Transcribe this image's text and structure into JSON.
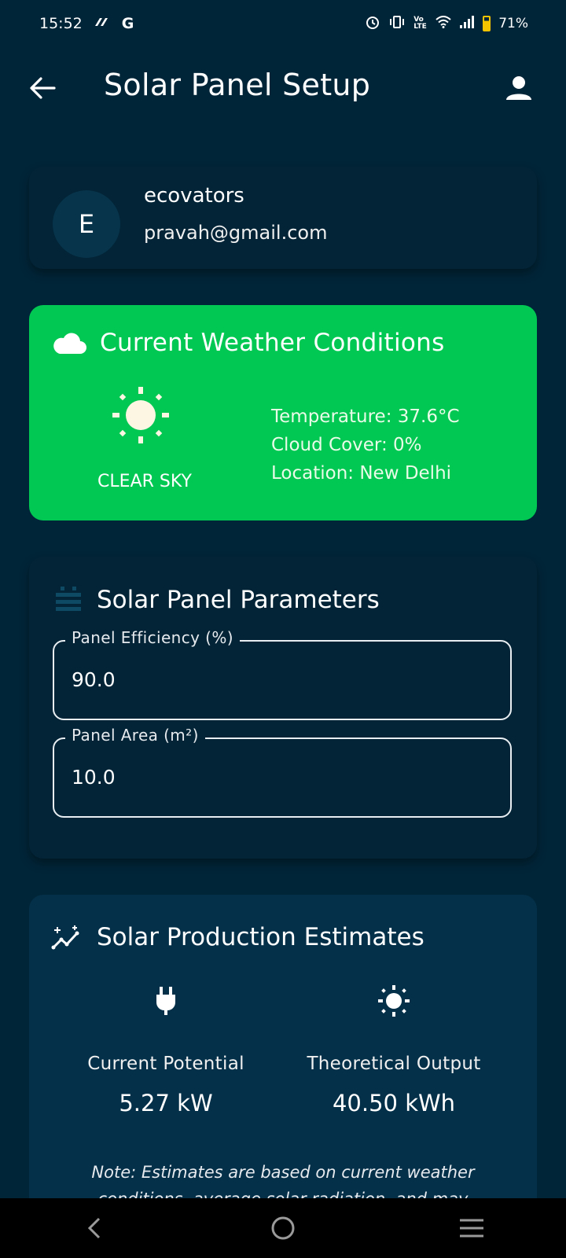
{
  "status_bar": {
    "time": "15:52",
    "carrier_icon": "G",
    "network_label": "Vo LTE",
    "battery": "71%",
    "battery_level": 0.71
  },
  "app_bar": {
    "title": "Solar Panel Setup",
    "back_icon": "arrow-left-icon",
    "profile_icon": "person-icon"
  },
  "user": {
    "avatar_letter": "E",
    "name": "ecovators",
    "email": "pravah@gmail.com"
  },
  "weather": {
    "title": "Current Weather Conditions",
    "icon": "cloud-icon",
    "condition_icon": "sun-icon",
    "condition": "CLEAR SKY",
    "temperature": "Temperature: 37.6°C",
    "cloud_cover": "Cloud Cover: 0%",
    "location": "Location: New Delhi",
    "card_color": "#00c853"
  },
  "parameters": {
    "title": "Solar Panel Parameters",
    "icon": "solar-panel-icon",
    "efficiency_label": "Panel Efficiency (%)",
    "efficiency_value": "90.0",
    "area_label": "Panel Area (m²)",
    "area_value": "10.0"
  },
  "estimates": {
    "title": "Solar Production Estimates",
    "icon": "insights-icon",
    "current_potential_label": "Current Potential",
    "current_potential_value": "5.27 kW",
    "theoretical_output_label": "Theoretical Output",
    "theoretical_output_value": "40.50 kWh",
    "note": "Note: Estimates are based on current weather conditions, average solar radiation, and may"
  },
  "colors": {
    "background": "#012538",
    "card": "#022436",
    "estimates_card": "#043049",
    "accent_green": "#00c853"
  }
}
